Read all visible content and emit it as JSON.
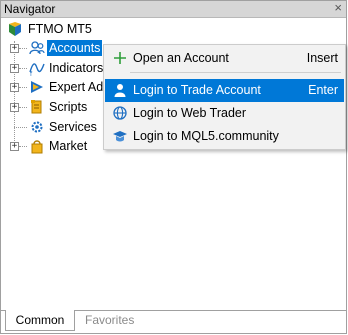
{
  "panel": {
    "title": "Navigator",
    "close_icon": "×"
  },
  "tree": {
    "root": {
      "label": "FTMO MT5",
      "icon": "terminal-logo-icon"
    },
    "items": [
      {
        "label": "Accounts",
        "icon": "accounts-icon",
        "selected": true
      },
      {
        "label": "Indicators",
        "icon": "indicators-icon"
      },
      {
        "label": "Expert Adv",
        "icon": "expert-advisors-icon"
      },
      {
        "label": "Scripts",
        "icon": "scripts-icon"
      },
      {
        "label": "Services",
        "icon": "services-icon"
      },
      {
        "label": "Market",
        "icon": "market-icon"
      }
    ]
  },
  "context_menu": {
    "items": [
      {
        "label": "Open an Account",
        "shortcut": "Insert",
        "icon": "plus-icon"
      },
      {
        "label": "Login to Trade Account",
        "shortcut": "Enter",
        "icon": "user-icon",
        "highlighted": true
      },
      {
        "label": "Login to Web Trader",
        "shortcut": "",
        "icon": "globe-icon"
      },
      {
        "label": "Login to MQL5.community",
        "shortcut": "",
        "icon": "mql5-cap-icon"
      }
    ]
  },
  "tabs": [
    {
      "label": "Common",
      "active": true
    },
    {
      "label": "Favorites",
      "active": false
    }
  ],
  "colors": {
    "selection": "#0078d7",
    "menu_bg": "#f2f2f2",
    "title_bg": "#d6d6d6"
  }
}
